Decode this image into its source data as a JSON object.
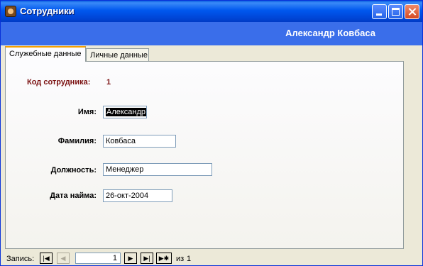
{
  "window": {
    "title": "Сотрудники"
  },
  "header": {
    "employee_name": "Александр Ковбаса"
  },
  "tabs": [
    {
      "label": "Служебные данные",
      "active": true
    },
    {
      "label": "Личные данные",
      "active": false
    }
  ],
  "form": {
    "employee_id_label": "Код сотрудника:",
    "employee_id_value": "1",
    "name_label": "Имя:",
    "name_value": "Александр",
    "surname_label": "Фамилия:",
    "surname_value": "Ковбаса",
    "position_label": "Должность:",
    "position_value": "Менеджер",
    "hire_date_label": "Дата найма:",
    "hire_date_value": "26-окт-2004"
  },
  "navigation": {
    "label": "Запись:",
    "current_record": "1",
    "of_label": "из",
    "total_records": "1",
    "icons": [
      "first-record-icon",
      "prev-record-icon",
      "next-record-icon",
      "last-record-icon",
      "new-record-icon"
    ]
  },
  "colors": {
    "titlebar": "#0058EE",
    "header_banner": "#3A6EEA",
    "id_text": "#7A1010",
    "active_tab_accent": "#F5A000"
  }
}
